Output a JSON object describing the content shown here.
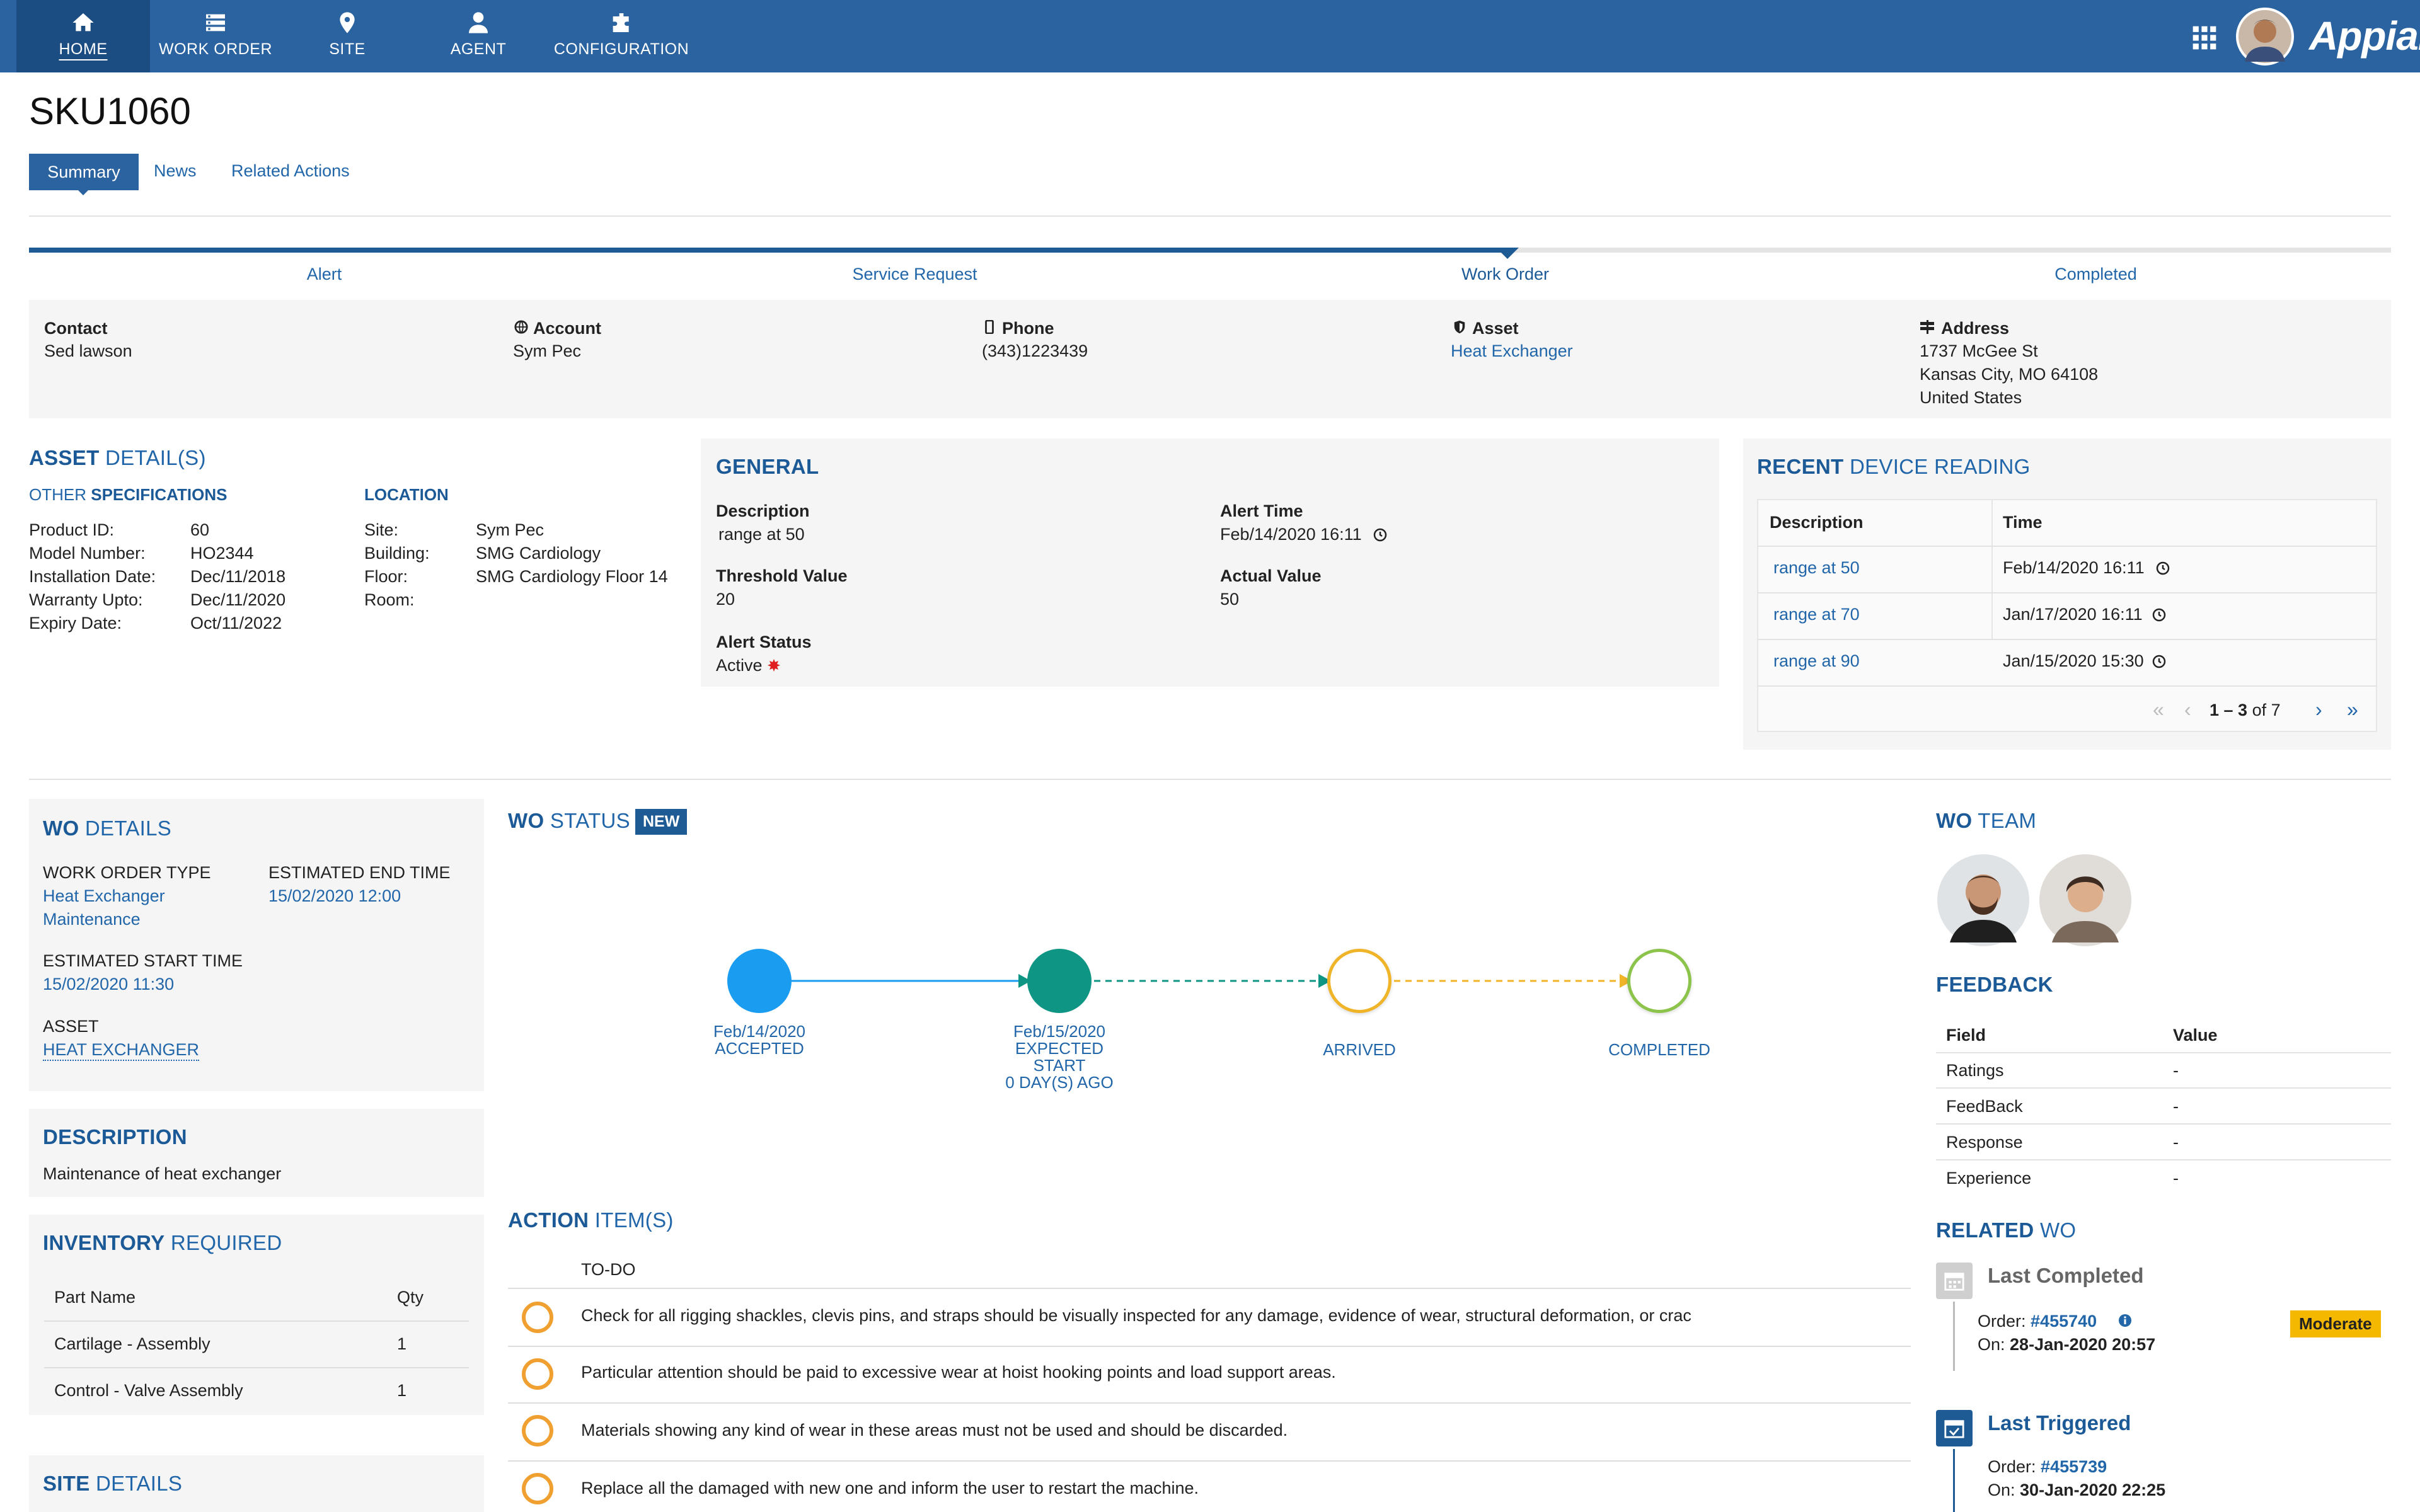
{
  "nav": {
    "items": [
      {
        "label": "HOME",
        "icon": "home-icon"
      },
      {
        "label": "WORK ORDER",
        "icon": "list-icon"
      },
      {
        "label": "SITE",
        "icon": "map-pin-icon"
      },
      {
        "label": "AGENT",
        "icon": "user-icon"
      },
      {
        "label": "CONFIGURATION",
        "icon": "puzzle-icon"
      }
    ],
    "brand": "Appian"
  },
  "page": {
    "title": "SKU1060"
  },
  "tabs": [
    "Summary",
    "News",
    "Related Actions"
  ],
  "progress": {
    "steps": [
      "Alert",
      "Service Request",
      "Work Order",
      "Completed"
    ],
    "current": "Work Order"
  },
  "contact_bar": {
    "contact": {
      "label": "Contact",
      "value": "Sed lawson"
    },
    "account": {
      "label": "Account",
      "value": "Sym Pec"
    },
    "phone": {
      "label": "Phone",
      "value": "(343)1223439"
    },
    "asset": {
      "label": "Asset",
      "value": "Heat Exchanger"
    },
    "address": {
      "label": "Address",
      "line1": "1737 McGee St",
      "line2": "Kansas City, MO 64108",
      "line3": "United States"
    }
  },
  "asset_details": {
    "title_bold": "ASSET",
    "title_rest": " DETAIL(S)",
    "other_prefix": "OTHER ",
    "other_bold": "SPECIFICATIONS",
    "specs": [
      {
        "k": "Product ID:",
        "v": "60"
      },
      {
        "k": "Model Number:",
        "v": "HO2344"
      },
      {
        "k": "Installation Date:",
        "v": "Dec/11/2018"
      },
      {
        "k": "Warranty Upto:",
        "v": "Dec/11/2020"
      },
      {
        "k": "Expiry Date:",
        "v": "Oct/11/2022"
      }
    ],
    "location_title": "LOCATION",
    "location": [
      {
        "k": "Site:",
        "v": "Sym Pec"
      },
      {
        "k": "Building:",
        "v": "SMG Cardiology"
      },
      {
        "k": "Floor:",
        "v": "SMG Cardiology Floor 14"
      },
      {
        "k": "Room:",
        "v": ""
      }
    ]
  },
  "general": {
    "title": "GENERAL",
    "description_label": "Description",
    "description": "range at 50",
    "alert_time_label": "Alert Time",
    "alert_time": "Feb/14/2020 16:11",
    "threshold_label": "Threshold Value",
    "threshold": "20",
    "actual_label": "Actual Value",
    "actual": "50",
    "status_label": "Alert Status",
    "status": "Active",
    "status_color": "#e02020"
  },
  "device_reading": {
    "title_bold": "RECENT",
    "title_rest": " DEVICE READING",
    "headers": [
      "Description",
      "Time"
    ],
    "rows": [
      {
        "desc": "range at 50",
        "time": "Feb/14/2020 16:11"
      },
      {
        "desc": "range at 70",
        "time": "Jan/17/2020 16:11"
      },
      {
        "desc": "range at 90",
        "time": "Jan/15/2020 15:30"
      }
    ],
    "pager_range": "1 – 3",
    "pager_of": " of 7"
  },
  "wo_details": {
    "title_bold": "WO",
    "title_rest": " DETAILS",
    "type_label": "WORK ORDER TYPE",
    "type_line1": "Heat Exchanger",
    "type_line2": "Maintenance",
    "end_label": "ESTIMATED END TIME",
    "end": "15/02/2020 12:00",
    "start_label": "ESTIMATED START TIME",
    "start": "15/02/2020 11:30",
    "asset_label": "ASSET",
    "asset": "HEAT EXCHANGER"
  },
  "description": {
    "title": "DESCRIPTION",
    "text": "Maintenance of heat exchanger"
  },
  "inventory": {
    "title_bold": "INVENTORY",
    "title_rest": " REQUIRED",
    "headers": [
      "Part Name",
      "Qty"
    ],
    "rows": [
      {
        "part": "Cartilage - Assembly",
        "qty": "1"
      },
      {
        "part": "Control - Valve Assembly",
        "qty": "1"
      }
    ]
  },
  "site_details": {
    "title_bold": "SITE",
    "title_rest": " DETAILS"
  },
  "wo_status": {
    "title_bold": "WO",
    "title_rest": " STATUS",
    "badge": "NEW",
    "nodes": [
      {
        "line1": "Feb/14/2020",
        "line2": "ACCEPTED",
        "line3": "",
        "line4": "",
        "color": "#1a9cf0",
        "filled": true
      },
      {
        "line1": "Feb/15/2020",
        "line2": "EXPECTED",
        "line3": "START",
        "line4": "0 DAY(S) AGO",
        "color": "#0e9584",
        "filled": true
      },
      {
        "line1": "",
        "line2": "ARRIVED",
        "line3": "",
        "line4": "",
        "color": "#f0b429",
        "filled": false
      },
      {
        "line1": "",
        "line2": "COMPLETED",
        "line3": "",
        "line4": "",
        "color": "#8cc34a",
        "filled": false
      }
    ]
  },
  "action_items": {
    "title_bold": "ACTION",
    "title_rest": " ITEM(S)",
    "header": "TO-DO",
    "items": [
      "Check for all rigging shackles, clevis pins, and straps should be visually inspected for any damage, evidence of wear, structural deformation, or crac",
      "Particular attention should be paid to excessive wear at hoist hooking points and load support areas.",
      "Materials showing any kind of wear in these areas must not be used and should be discarded.",
      "Replace all the damaged with new one and inform the user to restart the machine."
    ]
  },
  "wo_team": {
    "title_bold": "WO",
    "title_rest": " TEAM"
  },
  "feedback": {
    "title": "FEEDBACK",
    "headers": [
      "Field",
      "Value"
    ],
    "rows": [
      {
        "f": "Ratings",
        "v": "-"
      },
      {
        "f": "FeedBack",
        "v": "-"
      },
      {
        "f": "Response",
        "v": "-"
      },
      {
        "f": "Experience",
        "v": "-"
      }
    ]
  },
  "related_wo": {
    "title_bold": "RELATED",
    "title_rest": " WO",
    "last_completed": {
      "title": "Last Completed",
      "order_label": "Order: ",
      "order": "#455740",
      "on_label": "On: ",
      "on": "28-Jan-2020 20:57",
      "badge": "Moderate"
    },
    "last_triggered": {
      "title": "Last Triggered",
      "order_label": "Order: ",
      "order": "#455739",
      "on_label": "On: ",
      "on": "30-Jan-2020 22:25"
    }
  }
}
